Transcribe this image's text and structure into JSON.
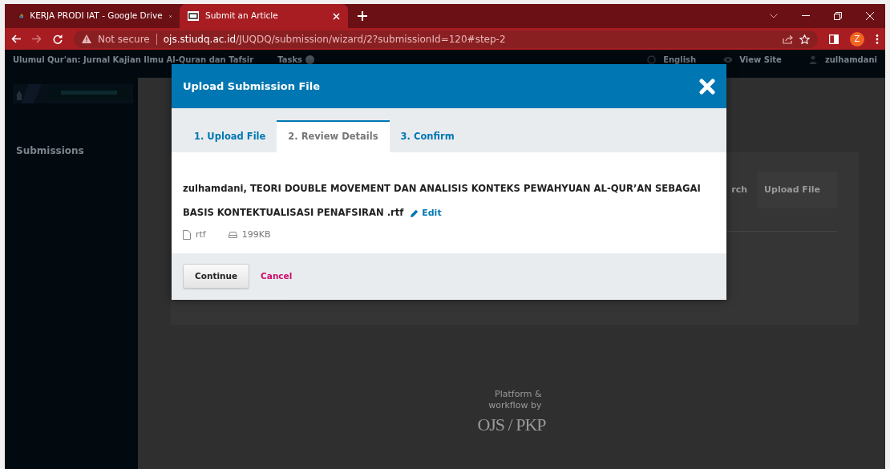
{
  "browser": {
    "tabs": [
      {
        "title": "KERJA PRODI IAT - Google Drive",
        "kind": "drive",
        "selected": false
      },
      {
        "title": "Submit an Article",
        "kind": "pkp",
        "selected": true
      }
    ],
    "address": {
      "security": "Not secure",
      "host": "ojs.stiudq.ac.id",
      "path": "/JUQDQ/submission/wizard/2?submissionId=120#step-2"
    },
    "profile_initial": "Z"
  },
  "site_header": {
    "journal_title": "Ulumul Qur'an: Jurnal Kajian Ilmu Al-Quran dan Tafsir",
    "tasks_label": "Tasks",
    "links": [
      {
        "label": "English",
        "kind": "globe"
      },
      {
        "label": "View Site",
        "kind": "eye"
      },
      {
        "label": "zulhamdani",
        "kind": "user"
      }
    ]
  },
  "sidebar": {
    "items": [
      "Submissions"
    ]
  },
  "background_panel": {
    "tabs": [
      "rch",
      "Upload File"
    ]
  },
  "footer": {
    "text": "Platform & workflow by",
    "logo": "OJS / PKP"
  },
  "modal": {
    "title": "Upload Submission File",
    "steps": [
      {
        "label": "1. Upload File",
        "selected": false
      },
      {
        "label": "2. Review Details",
        "selected": true
      },
      {
        "label": "3. Confirm",
        "selected": false
      }
    ],
    "file_title": "zulhamdani, TEORI DOUBLE MOVEMENT DAN ANALISIS KONTEKS PEWAHYUAN AL-QUR’AN SEBAGAI BASIS KONTEKTUALISASI PENAFSIRAN .rtf",
    "edit_link": "Edit",
    "file_type": "rtf",
    "file_size": "199KB",
    "buttons": [
      {
        "label": "Continue",
        "kind": "primary"
      },
      {
        "label": "Cancel",
        "kind": "link"
      }
    ]
  }
}
